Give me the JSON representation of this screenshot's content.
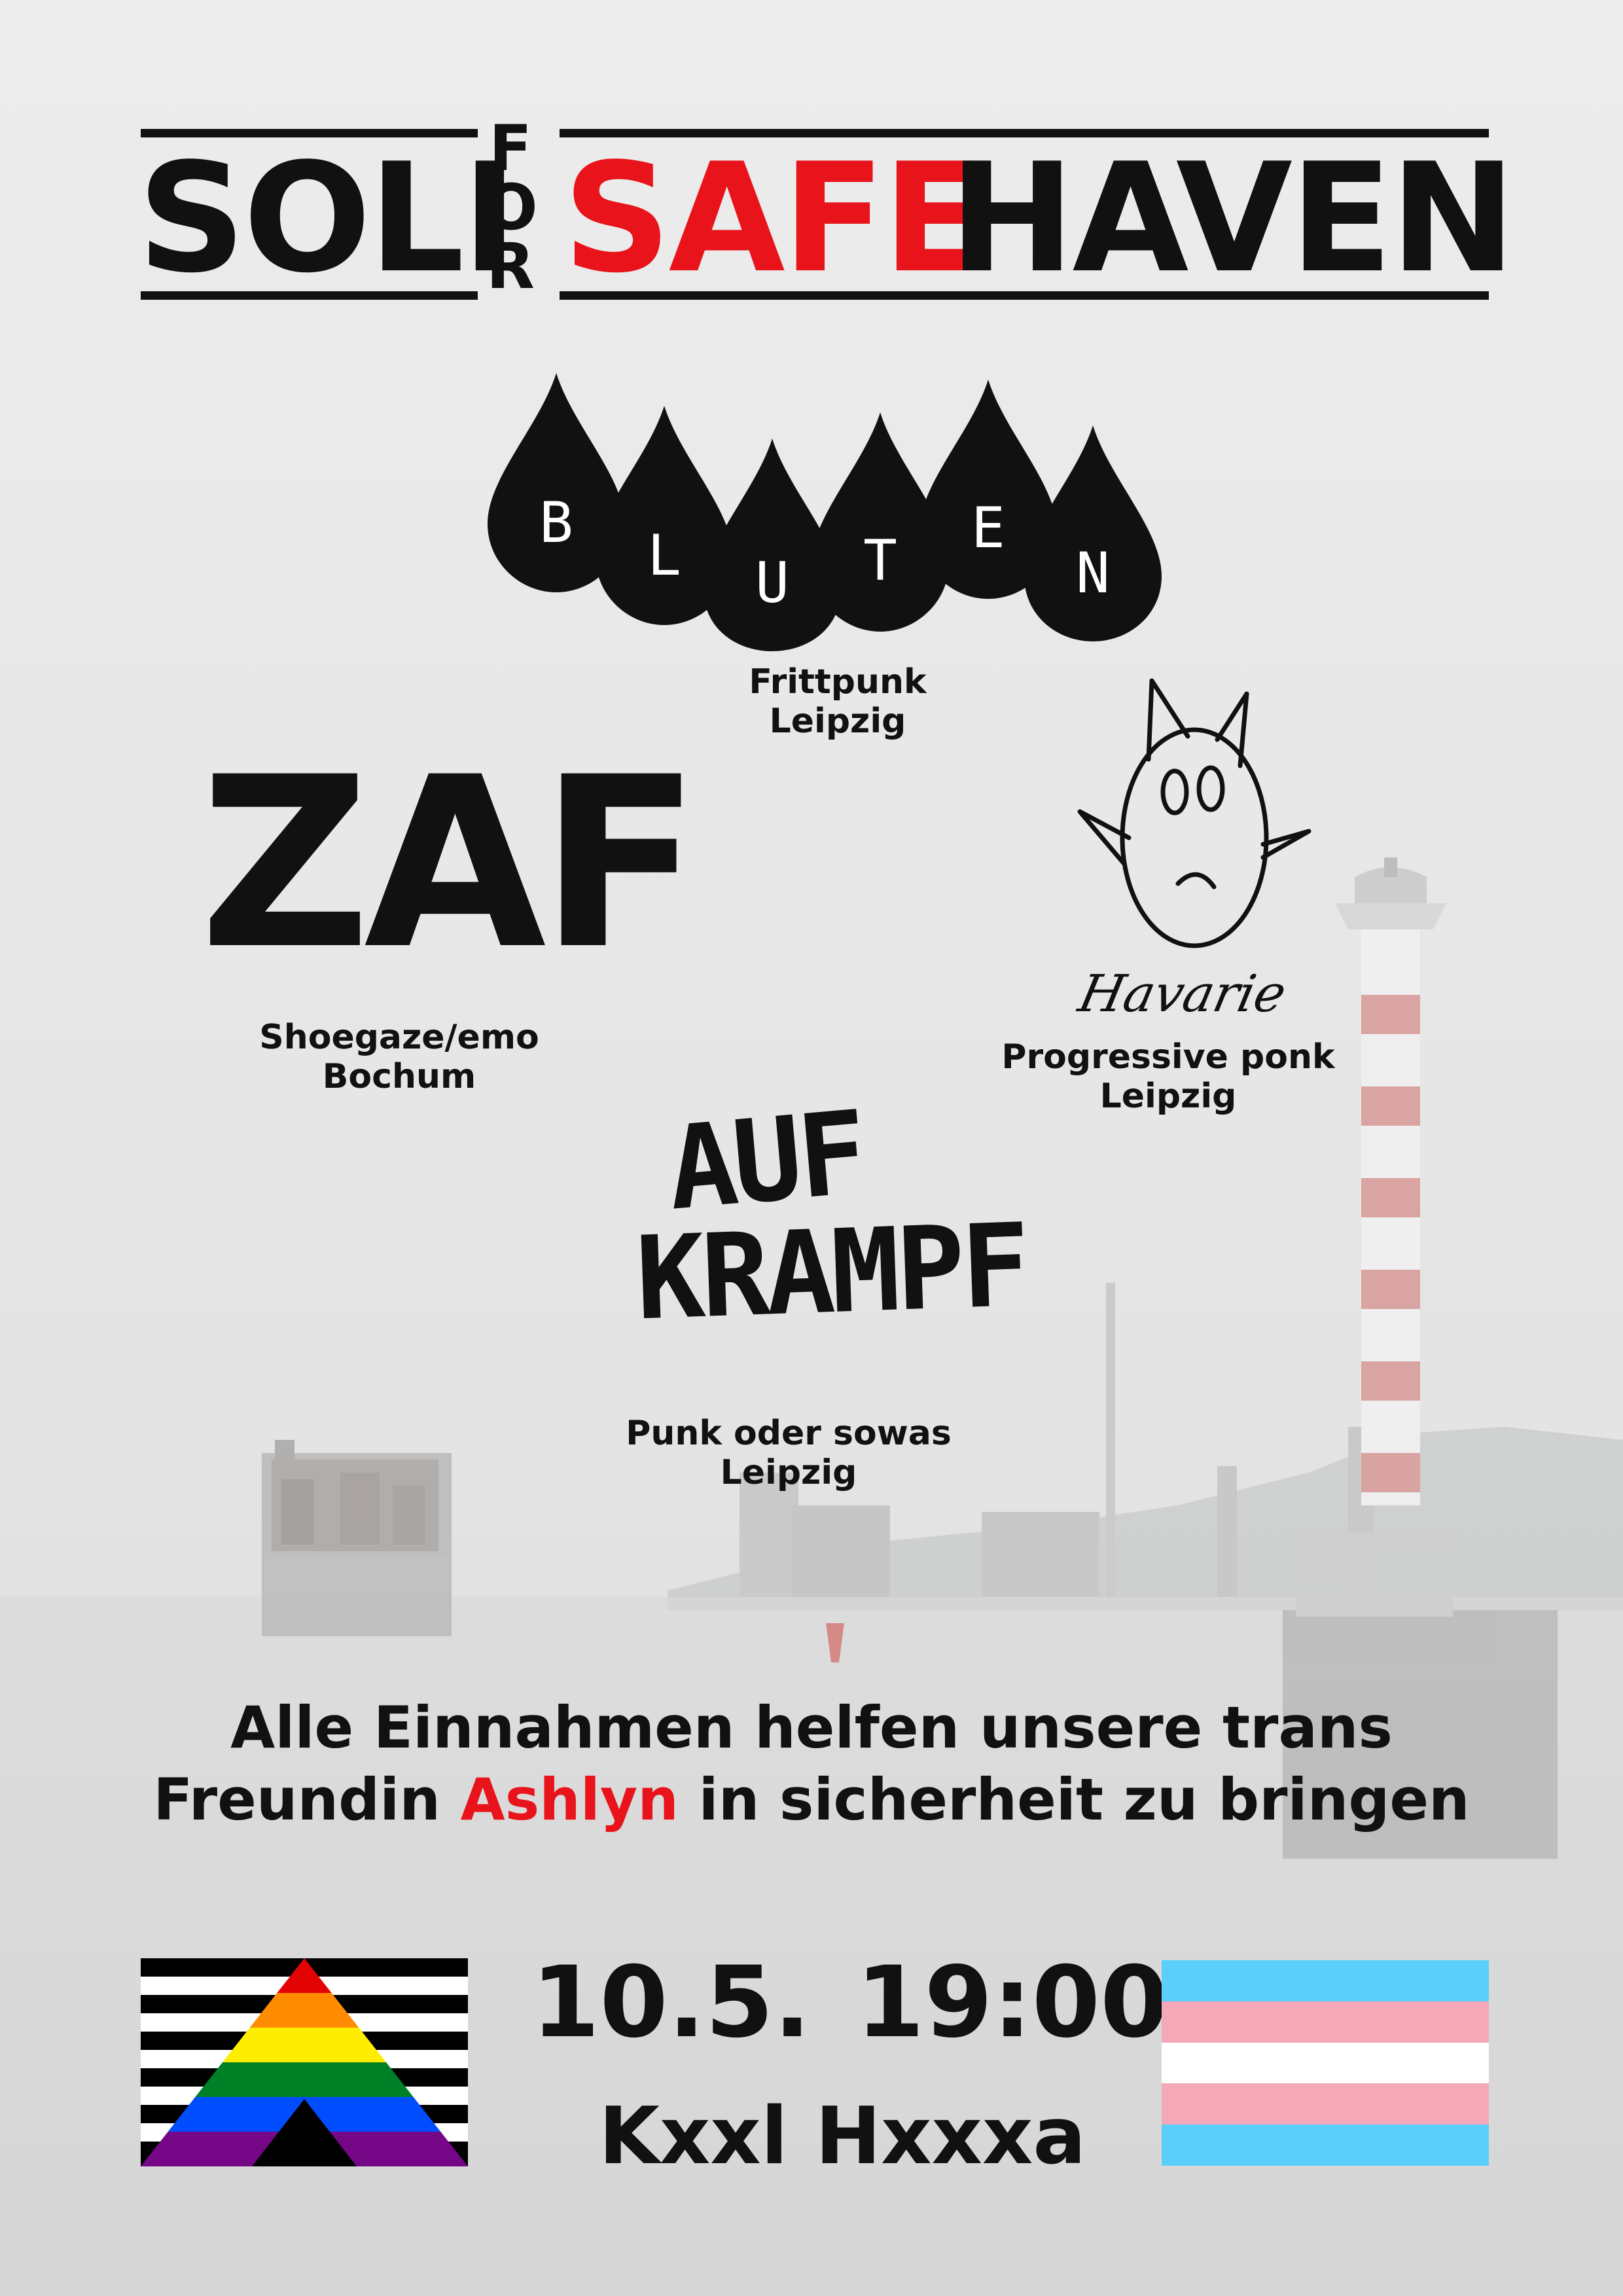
{
  "title": {
    "word_solidarity": "SOLI",
    "word_for": [
      "F",
      "O",
      "R"
    ],
    "word_safe": "SAFE",
    "word_haven": "HAVEN"
  },
  "bands": [
    {
      "logo_text": [
        "B",
        "L",
        "U",
        "T",
        "E",
        "N"
      ],
      "genre": "Frittpunk",
      "city": "Leipzig"
    },
    {
      "logo_text": "ZAF",
      "genre": "Shoegaze/emo",
      "city": "Bochum"
    },
    {
      "logo_text": "Havarie",
      "genre": "Progressive ponk",
      "city": "Leipzig"
    },
    {
      "logo_text": [
        "AUF",
        "KRAMPF"
      ],
      "genre": "Punk oder sowas",
      "city": "Leipzig"
    }
  ],
  "message": {
    "line1": "Alle Einnahmen helfen unsere trans",
    "line2_before": "Freundin ",
    "line2_name": "Ashlyn",
    "line2_after": " in sicherheit zu bringen"
  },
  "event": {
    "date": "10.5.",
    "time": "19:00",
    "venue": "Kxxl Hxxxa"
  },
  "colors": {
    "ink": "#111111",
    "accent_red": "#e8131b",
    "trans_blue": "#5bcefa",
    "trans_pink": "#f5a9b8",
    "trans_white": "#ffffff"
  },
  "icons": [
    "straight-ally-flag-icon",
    "transgender-flag-icon",
    "sad-face-icon",
    "blood-drop-icon"
  ]
}
